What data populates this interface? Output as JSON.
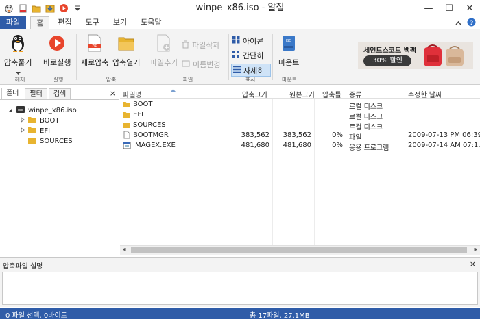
{
  "window": {
    "title": "winpe_x86.iso - 알집",
    "minimize_glyph": "—",
    "maximize_glyph": "☐",
    "close_glyph": "✕"
  },
  "tabs": [
    {
      "label": "파일"
    },
    {
      "label": "홈"
    },
    {
      "label": "편집"
    },
    {
      "label": "도구"
    },
    {
      "label": "보기"
    },
    {
      "label": "도움말"
    }
  ],
  "ribbon": {
    "extract": {
      "label": "압축풀기",
      "group": "해제"
    },
    "run": {
      "label": "바로실행",
      "group": "실행"
    },
    "new_compress": {
      "label": "새로압축"
    },
    "open_compress": {
      "label": "압축열기"
    },
    "compress_group": "압축",
    "add_file": {
      "label": "파일추가"
    },
    "delete_file": {
      "label": "파일삭제"
    },
    "rename": {
      "label": "이름변경"
    },
    "file_group": "파일",
    "view_icon": {
      "label": "아이콘"
    },
    "view_simple": {
      "label": "간단히"
    },
    "view_detail": {
      "label": "자세히"
    },
    "view_group": "표시",
    "mount": {
      "label": "마운트",
      "group": "마운트",
      "icon_text": "ISO"
    },
    "new_compress_icon_text": "ZIP",
    "ad": {
      "line1": "세인트스코트 백팩",
      "line2": "30% 할인"
    }
  },
  "left_panel": {
    "tabs": [
      "폴더",
      "필터",
      "검색"
    ],
    "close": "×",
    "tree": {
      "root": "winpe_x86.iso",
      "root_icon_text": "ISO",
      "children": [
        "BOOT",
        "EFI",
        "SOURCES"
      ]
    }
  },
  "file_list": {
    "columns": [
      "파일명",
      "압축크기",
      "원본크기",
      "압축률",
      "종류",
      "수정한 날짜"
    ],
    "rows": [
      {
        "name": "BOOT",
        "packed": "",
        "size": "",
        "ratio": "",
        "type": "로컬 디스크",
        "modified": "",
        "kind": "folder"
      },
      {
        "name": "EFI",
        "packed": "",
        "size": "",
        "ratio": "",
        "type": "로컬 디스크",
        "modified": "",
        "kind": "folder"
      },
      {
        "name": "SOURCES",
        "packed": "",
        "size": "",
        "ratio": "",
        "type": "로컬 디스크",
        "modified": "",
        "kind": "folder"
      },
      {
        "name": "BOOTMGR",
        "packed": "383,562",
        "size": "383,562",
        "ratio": "0%",
        "type": "파일",
        "modified": "2009-07-13 PM 06:39...",
        "kind": "file"
      },
      {
        "name": "IMAGEX.EXE",
        "packed": "481,680",
        "size": "481,680",
        "ratio": "0%",
        "type": "응용 프로그램",
        "modified": "2009-07-14 AM 07:1...",
        "kind": "exe"
      }
    ]
  },
  "description_panel": {
    "title": "압축파일 설명",
    "close": "×"
  },
  "status": {
    "selection": "0 파일 선택,  0바이트",
    "total": "총 17파일,  27.1MB"
  },
  "colors": {
    "accent": "#2f5ca8",
    "ribbon_bg": "#f3f3f3",
    "selected_bg": "#cfe3f7",
    "folder": "#e8b430"
  }
}
